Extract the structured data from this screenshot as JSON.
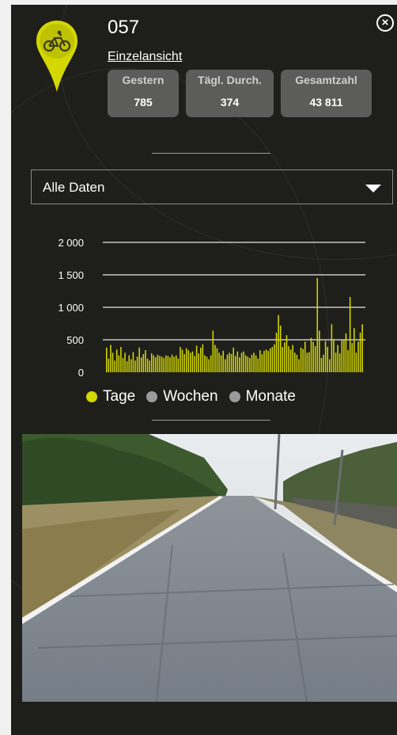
{
  "station": {
    "title": "057",
    "detail_link": "Einzelansicht",
    "icon": "bicycle-icon",
    "pin_color": "#d4d700"
  },
  "close_icon": "close-circle-icon",
  "stats": [
    {
      "label": "Gestern",
      "value": "785"
    },
    {
      "label": "Tägl. Durch.",
      "value": "374"
    },
    {
      "label": "Gesamtzahl",
      "value": "43 811"
    }
  ],
  "filter": {
    "selected": "Alle Daten"
  },
  "legend": [
    {
      "label": "Tage",
      "color": "#d4d700"
    },
    {
      "label": "Wochen",
      "color": "#9a9a9a"
    },
    {
      "label": "Monate",
      "color": "#9a9a9a"
    }
  ],
  "chart_data": {
    "type": "bar",
    "title": "",
    "xlabel": "",
    "ylabel": "",
    "ylim": [
      0,
      2000
    ],
    "yticks": [
      "0",
      "500",
      "1 000",
      "1 500",
      "2 000"
    ],
    "grid": true,
    "bar_color": "#d4d700",
    "values": [
      380,
      210,
      420,
      300,
      180,
      350,
      260,
      390,
      220,
      300,
      170,
      260,
      200,
      310,
      180,
      240,
      380,
      230,
      280,
      340,
      210,
      180,
      290,
      260,
      230,
      270,
      250,
      240,
      220,
      260,
      250,
      230,
      270,
      240,
      260,
      210,
      390,
      350,
      280,
      370,
      340,
      300,
      320,
      250,
      410,
      290,
      380,
      430,
      260,
      240,
      200,
      260,
      640,
      420,
      370,
      300,
      260,
      330,
      200,
      270,
      300,
      280,
      380,
      250,
      320,
      230,
      300,
      320,
      260,
      240,
      220,
      270,
      300,
      260,
      210,
      340,
      280,
      330,
      350,
      330,
      370,
      390,
      430,
      610,
      880,
      720,
      390,
      460,
      570,
      400,
      350,
      420,
      300,
      270,
      200,
      380,
      360,
      470,
      300,
      310,
      530,
      470,
      400,
      1450,
      640,
      220,
      270,
      480,
      390,
      200,
      740,
      510,
      300,
      420,
      290,
      490,
      510,
      600,
      340,
      1160,
      450,
      680,
      300,
      470,
      610,
      740
    ]
  }
}
